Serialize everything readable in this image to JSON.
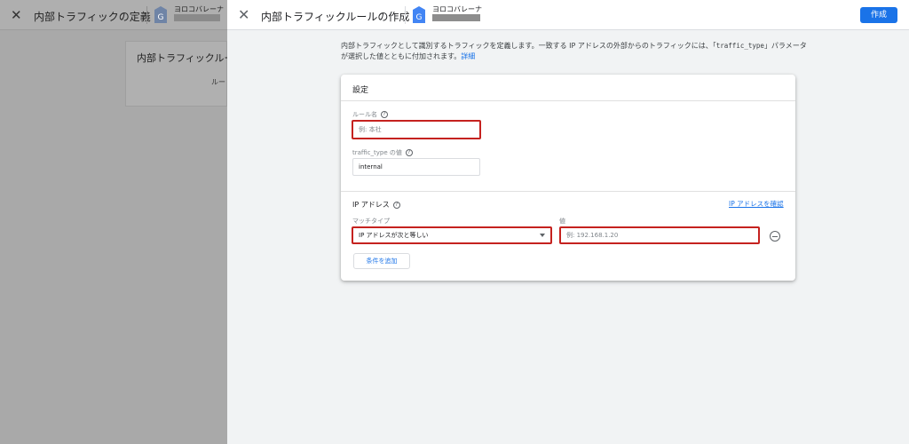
{
  "background": {
    "title": "内部トラフィックの定義",
    "account_name": "ヨロコバレーナ",
    "card_title": "内部トラフィックルール",
    "card_text": "ルー"
  },
  "header": {
    "title": "内部トラフィックルールの作成",
    "account_name": "ヨロコバレーナ",
    "create_label": "作成"
  },
  "description": {
    "text_before": "内部トラフィックとして識別するトラフィックを定義します。一致する IP アドレスの外部からのトラフィックには、「",
    "param": "traffic_type",
    "text_after": "」パラメータが選択した値とともに付加されます。",
    "link": "詳細"
  },
  "settings": {
    "title": "設定",
    "rule_name_label": "ルール名",
    "rule_name_placeholder": "例: 本社",
    "traffic_type_label": "traffic_type の値",
    "traffic_type_value": "internal"
  },
  "ip": {
    "title": "IP アドレス",
    "check_link": "IP アドレスを確認",
    "match_type_label": "マッチタイプ",
    "match_type_value": "IP アドレスが次と等しい",
    "value_label": "値",
    "value_placeholder": "例: 192.168.1.20",
    "add_condition": "条件を追加"
  },
  "colors": {
    "accent": "#1a73e8",
    "highlight": "#c5221f"
  }
}
